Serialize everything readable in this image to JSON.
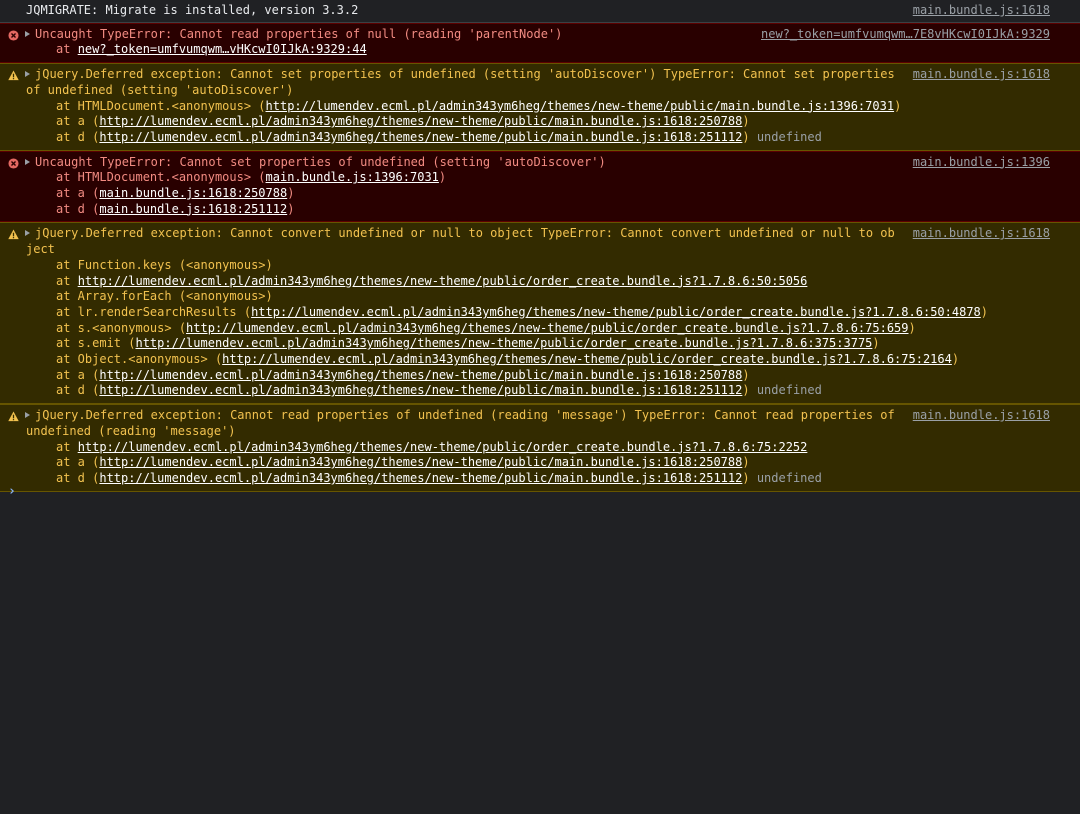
{
  "messages": [
    {
      "level": "log",
      "text": "JQMIGRATE: Migrate is installed, version 3.3.2",
      "source": "main.bundle.js:1618"
    },
    {
      "level": "error",
      "text": "Uncaught TypeError: Cannot read properties of null (reading 'parentNode')",
      "source": "new?_token=umfvumqwm…7E8vHKcwI0IJkA:9329",
      "frames": [
        {
          "prefix": "at ",
          "loc": "new?_token=umfvumqwm…vHKcwI0IJkA:9329:44",
          "suffix": ""
        }
      ]
    },
    {
      "level": "warn",
      "text": "jQuery.Deferred exception: Cannot set properties of undefined (setting 'autoDiscover') TypeError: Cannot set properties of undefined (setting 'autoDiscover')",
      "source": "main.bundle.js:1618",
      "frames": [
        {
          "prefix": "at HTMLDocument.<anonymous> (",
          "loc": "http://lumendev.ecml.pl/admin343ym6heg/themes/new-theme/public/main.bundle.js:1396:7031",
          "suffix": ")"
        },
        {
          "prefix": "at a (",
          "loc": "http://lumendev.ecml.pl/admin343ym6heg/themes/new-theme/public/main.bundle.js:1618:250788",
          "suffix": ")"
        },
        {
          "prefix": "at d (",
          "loc": "http://lumendev.ecml.pl/admin343ym6heg/themes/new-theme/public/main.bundle.js:1618:251112",
          "suffix": ")",
          "tail": "undefined"
        }
      ]
    },
    {
      "level": "error",
      "text": "Uncaught TypeError: Cannot set properties of undefined (setting 'autoDiscover')",
      "source": "main.bundle.js:1396",
      "frames": [
        {
          "prefix": "at HTMLDocument.<anonymous> (",
          "loc": "main.bundle.js:1396:7031",
          "suffix": ")"
        },
        {
          "prefix": "at a (",
          "loc": "main.bundle.js:1618:250788",
          "suffix": ")"
        },
        {
          "prefix": "at d (",
          "loc": "main.bundle.js:1618:251112",
          "suffix": ")"
        }
      ]
    },
    {
      "level": "warn",
      "text": "jQuery.Deferred exception: Cannot convert undefined or null to object TypeError: Cannot convert undefined or null to object",
      "source": "main.bundle.js:1618",
      "frames": [
        {
          "prefix": "at Function.keys (<anonymous>)",
          "loc": "",
          "suffix": ""
        },
        {
          "prefix": "at ",
          "loc": "http://lumendev.ecml.pl/admin343ym6heg/themes/new-theme/public/order_create.bundle.js?1.7.8.6:50:5056",
          "suffix": ""
        },
        {
          "prefix": "at Array.forEach (<anonymous>)",
          "loc": "",
          "suffix": ""
        },
        {
          "prefix": "at lr.renderSearchResults (",
          "loc": "http://lumendev.ecml.pl/admin343ym6heg/themes/new-theme/public/order_create.bundle.js?1.7.8.6:50:4878",
          "suffix": ")"
        },
        {
          "prefix": "at s.<anonymous> (",
          "loc": "http://lumendev.ecml.pl/admin343ym6heg/themes/new-theme/public/order_create.bundle.js?1.7.8.6:75:659",
          "suffix": ")"
        },
        {
          "prefix": "at s.emit (",
          "loc": "http://lumendev.ecml.pl/admin343ym6heg/themes/new-theme/public/order_create.bundle.js?1.7.8.6:375:3775",
          "suffix": ")"
        },
        {
          "prefix": "at Object.<anonymous> (",
          "loc": "http://lumendev.ecml.pl/admin343ym6heg/themes/new-theme/public/order_create.bundle.js?1.7.8.6:75:2164",
          "suffix": ")"
        },
        {
          "prefix": "at a (",
          "loc": "http://lumendev.ecml.pl/admin343ym6heg/themes/new-theme/public/main.bundle.js:1618:250788",
          "suffix": ")"
        },
        {
          "prefix": "at d (",
          "loc": "http://lumendev.ecml.pl/admin343ym6heg/themes/new-theme/public/main.bundle.js:1618:251112",
          "suffix": ")",
          "tail": "undefined"
        }
      ]
    },
    {
      "level": "warn",
      "text": "jQuery.Deferred exception: Cannot read properties of undefined (reading 'message') TypeError: Cannot read properties of undefined (reading 'message')",
      "source": "main.bundle.js:1618",
      "frames": [
        {
          "prefix": "at ",
          "loc": "http://lumendev.ecml.pl/admin343ym6heg/themes/new-theme/public/order_create.bundle.js?1.7.8.6:75:2252",
          "suffix": ""
        },
        {
          "prefix": "at a (",
          "loc": "http://lumendev.ecml.pl/admin343ym6heg/themes/new-theme/public/main.bundle.js:1618:250788",
          "suffix": ")"
        },
        {
          "prefix": "at d (",
          "loc": "http://lumendev.ecml.pl/admin343ym6heg/themes/new-theme/public/main.bundle.js:1618:251112",
          "suffix": ")",
          "tail": "undefined"
        }
      ]
    }
  ],
  "prompt": {
    "glyph": "›",
    "input_value": ""
  },
  "colors": {
    "background": "#202124",
    "error_bg": "#290000",
    "error_text": "#f28b82",
    "warn_bg": "#332b00",
    "warn_text": "#f2c24f",
    "prompt": "#8ab4f8"
  },
  "icons": {
    "error": "error-circle-icon",
    "warn": "warning-triangle-icon",
    "expand": "expand-triangle-icon"
  }
}
